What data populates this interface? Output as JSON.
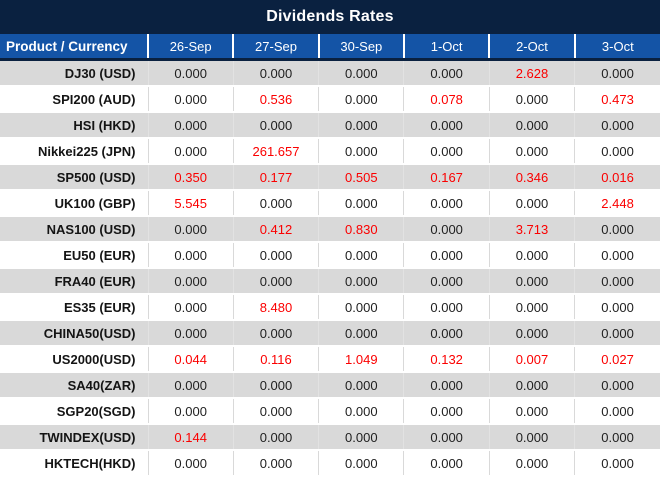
{
  "title": "Dividends Rates",
  "colors": {
    "title_bar_bg": "#0a2140",
    "header_bg": "#1454a6",
    "row_alt_bg": "#d9d9d9",
    "highlight_value": "#fb0000",
    "normal_value": "#1f1f1f"
  },
  "table": {
    "columns": [
      "Product / Currency",
      "26-Sep",
      "27-Sep",
      "30-Sep",
      "1-Oct",
      "2-Oct",
      "3-Oct"
    ],
    "rows": [
      {
        "product": "DJ30 (USD)",
        "values": [
          "0.000",
          "0.000",
          "0.000",
          "0.000",
          "2.628",
          "0.000"
        ],
        "red": [
          4
        ]
      },
      {
        "product": "SPI200 (AUD)",
        "values": [
          "0.000",
          "0.536",
          "0.000",
          "0.078",
          "0.000",
          "0.473"
        ],
        "red": [
          1,
          3,
          5
        ]
      },
      {
        "product": "HSI (HKD)",
        "values": [
          "0.000",
          "0.000",
          "0.000",
          "0.000",
          "0.000",
          "0.000"
        ],
        "red": []
      },
      {
        "product": "Nikkei225 (JPN)",
        "values": [
          "0.000",
          "261.657",
          "0.000",
          "0.000",
          "0.000",
          "0.000"
        ],
        "red": [
          1
        ]
      },
      {
        "product": "SP500 (USD)",
        "values": [
          "0.350",
          "0.177",
          "0.505",
          "0.167",
          "0.346",
          "0.016"
        ],
        "red": [
          0,
          1,
          2,
          3,
          4,
          5
        ]
      },
      {
        "product": "UK100 (GBP)",
        "values": [
          "5.545",
          "0.000",
          "0.000",
          "0.000",
          "0.000",
          "2.448"
        ],
        "red": [
          0,
          5
        ]
      },
      {
        "product": "NAS100 (USD)",
        "values": [
          "0.000",
          "0.412",
          "0.830",
          "0.000",
          "3.713",
          "0.000"
        ],
        "red": [
          1,
          2,
          4
        ]
      },
      {
        "product": "EU50 (EUR)",
        "values": [
          "0.000",
          "0.000",
          "0.000",
          "0.000",
          "0.000",
          "0.000"
        ],
        "red": []
      },
      {
        "product": "FRA40 (EUR)",
        "values": [
          "0.000",
          "0.000",
          "0.000",
          "0.000",
          "0.000",
          "0.000"
        ],
        "red": []
      },
      {
        "product": "ES35 (EUR)",
        "values": [
          "0.000",
          "8.480",
          "0.000",
          "0.000",
          "0.000",
          "0.000"
        ],
        "red": [
          1
        ]
      },
      {
        "product": "CHINA50(USD)",
        "values": [
          "0.000",
          "0.000",
          "0.000",
          "0.000",
          "0.000",
          "0.000"
        ],
        "red": []
      },
      {
        "product": "US2000(USD)",
        "values": [
          "0.044",
          "0.116",
          "1.049",
          "0.132",
          "0.007",
          "0.027"
        ],
        "red": [
          0,
          1,
          2,
          3,
          4,
          5
        ]
      },
      {
        "product": "SA40(ZAR)",
        "values": [
          "0.000",
          "0.000",
          "0.000",
          "0.000",
          "0.000",
          "0.000"
        ],
        "red": []
      },
      {
        "product": "SGP20(SGD)",
        "values": [
          "0.000",
          "0.000",
          "0.000",
          "0.000",
          "0.000",
          "0.000"
        ],
        "red": []
      },
      {
        "product": "TWINDEX(USD)",
        "values": [
          "0.144",
          "0.000",
          "0.000",
          "0.000",
          "0.000",
          "0.000"
        ],
        "red": [
          0
        ]
      },
      {
        "product": "HKTECH(HKD)",
        "values": [
          "0.000",
          "0.000",
          "0.000",
          "0.000",
          "0.000",
          "0.000"
        ],
        "red": []
      }
    ]
  }
}
